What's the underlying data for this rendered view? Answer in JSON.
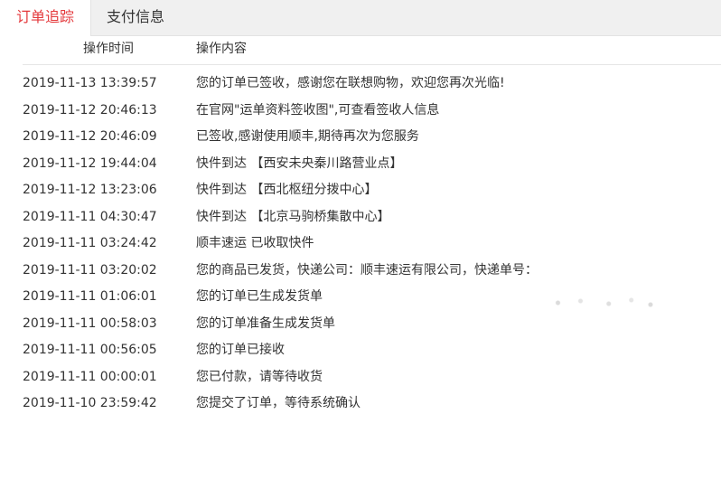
{
  "tabs": [
    {
      "label": "订单追踪",
      "active": true
    },
    {
      "label": "支付信息",
      "active": false
    }
  ],
  "colors": {
    "accent": "#e4393c",
    "text": "#333333",
    "tabbar_bg": "#f0f0f0",
    "divider": "#e6e6e6"
  },
  "table": {
    "headers": {
      "time": "操作时间",
      "content": "操作内容"
    },
    "rows": [
      {
        "time": "2019-11-13 13:39:57",
        "content": "您的订单已签收，感谢您在联想购物，欢迎您再次光临!"
      },
      {
        "time": "2019-11-12 20:46:13",
        "content": "在官网\"运单资料签收图\",可查看签收人信息"
      },
      {
        "time": "2019-11-12 20:46:09",
        "content": "已签收,感谢使用顺丰,期待再次为您服务"
      },
      {
        "time": "2019-11-12 19:44:04",
        "content": "快件到达 【西安未央秦川路营业点】"
      },
      {
        "time": "2019-11-12 13:23:06",
        "content": "快件到达 【西北枢纽分拨中心】"
      },
      {
        "time": "2019-11-11 04:30:47",
        "content": "快件到达 【北京马驹桥集散中心】"
      },
      {
        "time": "2019-11-11 03:24:42",
        "content": "顺丰速运 已收取快件"
      },
      {
        "time": "2019-11-11 03:20:02",
        "content": "您的商品已发货，快递公司：顺丰速运有限公司，快递单号："
      },
      {
        "time": "2019-11-11 01:06:01",
        "content": "您的订单已生成发货单"
      },
      {
        "time": "2019-11-11 00:58:03",
        "content": "您的订单准备生成发货单"
      },
      {
        "time": "2019-11-11 00:56:05",
        "content": "您的订单已接收"
      },
      {
        "time": "2019-11-11 00:00:01",
        "content": "您已付款，请等待收货"
      },
      {
        "time": "2019-11-10 23:59:42",
        "content": "您提交了订单，等待系统确认"
      }
    ]
  }
}
